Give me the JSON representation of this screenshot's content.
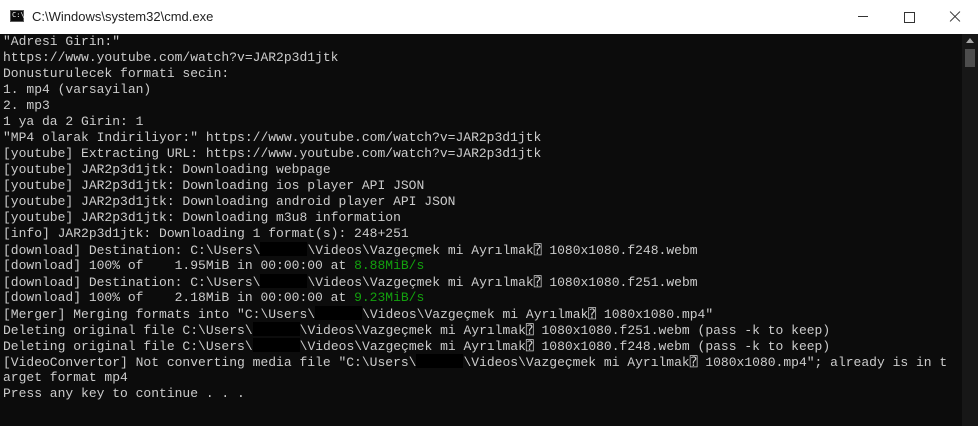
{
  "window": {
    "title": "C:\\Windows\\system32\\cmd.exe",
    "icon_text": "C:\\"
  },
  "controls": {
    "minimize": "minimize-icon",
    "maximize": "maximize-icon",
    "close": "close-icon"
  },
  "console": {
    "lines": [
      "\"Adresi Girin:\"",
      "https://www.youtube.com/watch?v=JAR2p3d1jtk",
      "Donusturulecek formati secin:",
      "1. mp4 (varsayilan)",
      "2. mp3",
      "1 ya da 2 Girin: 1",
      "\"MP4 olarak Indiriliyor:\" https://www.youtube.com/watch?v=JAR2p3d1jtk",
      "[youtube] Extracting URL: https://www.youtube.com/watch?v=JAR2p3d1jtk",
      "[youtube] JAR2p3d1jtk: Downloading webpage",
      "[youtube] JAR2p3d1jtk: Downloading ios player API JSON",
      "[youtube] JAR2p3d1jtk: Downloading android player API JSON",
      "[youtube] JAR2p3d1jtk: Downloading m3u8 information",
      "[info] JAR2p3d1jtk: Downloading 1 format(s): 248+251",
      {
        "before": "[download] Destination: C:\\Users\\",
        "after": "\\Videos\\Vazgeçmek mi Ayrılmak⍰ 1080x1080.f248.webm"
      },
      {
        "before": "[download] 100% of    1.95MiB in 00:00:00 at ",
        "green": "8.88MiB/s"
      },
      {
        "before": "[download] Destination: C:\\Users\\",
        "after": "\\Videos\\Vazgeçmek mi Ayrılmak⍰ 1080x1080.f251.webm"
      },
      {
        "before": "[download] 100% of    2.18MiB in 00:00:00 at ",
        "green": "9.23MiB/s"
      },
      {
        "before": "[Merger] Merging formats into \"C:\\Users\\",
        "after": "\\Videos\\Vazgeçmek mi Ayrılmak⍰ 1080x1080.mp4\""
      },
      {
        "before": "Deleting original file C:\\Users\\",
        "after": "\\Videos\\Vazgeçmek mi Ayrılmak⍰ 1080x1080.f251.webm (pass -k to keep)"
      },
      {
        "before": "Deleting original file C:\\Users\\",
        "after": "\\Videos\\Vazgeçmek mi Ayrılmak⍰ 1080x1080.f248.webm (pass -k to keep)"
      },
      {
        "before": "[VideoConvertor] Not converting media file \"C:\\Users\\",
        "after": "\\Videos\\Vazgeçmek mi Ayrılmak⍰ 1080x1080.mp4\"; already is in t"
      },
      "arget format mp4",
      "Press any key to continue . . ."
    ]
  },
  "colors": {
    "background": "#0c0c0c",
    "text": "#cccccc",
    "green": "#13a10e",
    "titlebar": "#ffffff"
  }
}
